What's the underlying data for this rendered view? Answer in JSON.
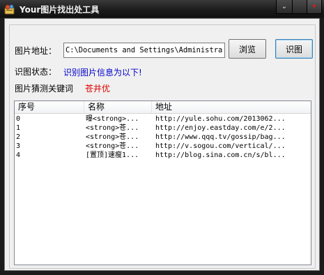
{
  "window": {
    "title": "Your图片找出处工具",
    "minimize_glyph": "⌄",
    "close_glyph": "▾"
  },
  "form": {
    "path_label": "图片地址：",
    "path_value": "C:\\Documents and Settings\\Administrato",
    "browse_label": "浏览",
    "identify_label": "识图",
    "status_label": "识图状态：",
    "status_value": "识别图片信息为以下!",
    "keyword_label": "图片猜测关键词",
    "keyword_value": "苍井优"
  },
  "table": {
    "columns": [
      "序号",
      "名称",
      "地址"
    ],
    "rows": [
      {
        "index": "0",
        "name": "曝<strong>...",
        "url": "http://yule.sohu.com/2013062..."
      },
      {
        "index": "1",
        "name": "<strong>苍...",
        "url": "http://enjoy.eastday.com/e/2..."
      },
      {
        "index": "2",
        "name": "<strong>苍...",
        "url": "http://www.qqq.tv/gossip/bag..."
      },
      {
        "index": "3",
        "name": "<strong>苍...",
        "url": "http://v.sogou.com/vertical/..."
      },
      {
        "index": "4",
        "name": "[置顶]速瘦1...",
        "url": "http://blog.sina.com.cn/s/bl..."
      }
    ]
  },
  "colors": {
    "status": "#0000cc",
    "keyword": "#e00000",
    "titlebar": "#1c1c1c"
  },
  "icons": [
    "app-icon",
    "minimize-icon",
    "close-icon"
  ]
}
